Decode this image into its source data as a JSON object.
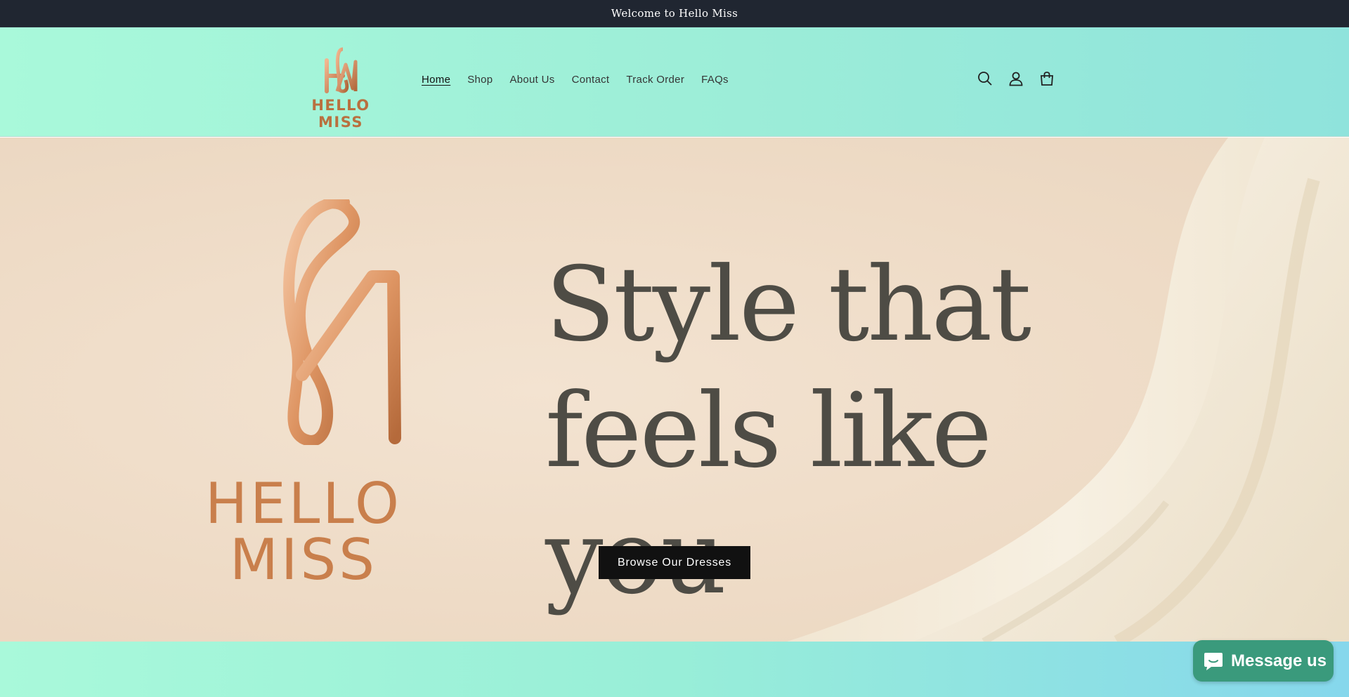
{
  "announcement": {
    "text": "Welcome to Hello Miss"
  },
  "header": {
    "logo_text": "HELLO MISS",
    "nav": [
      {
        "label": "Home",
        "active": true
      },
      {
        "label": "Shop"
      },
      {
        "label": "About Us"
      },
      {
        "label": "Contact"
      },
      {
        "label": "Track Order"
      },
      {
        "label": "FAQs"
      }
    ],
    "icons": [
      "search-icon",
      "account-icon",
      "cart-icon"
    ]
  },
  "hero": {
    "logo_text": "HELLO MISS",
    "heading_line1": "Style that",
    "heading_line2": "feels like you",
    "button_label": "Browse Our Dresses"
  },
  "chat": {
    "label": "Message us",
    "icon": "chat-bubble-icon"
  },
  "colors": {
    "announcement_bg": "#202631",
    "header_gradient_start": "#a9f9da",
    "header_gradient_end": "#8fe3dc",
    "brand_copper": "#c97f4c",
    "button_bg": "#111111",
    "chat_bg": "#3a9a7c"
  }
}
